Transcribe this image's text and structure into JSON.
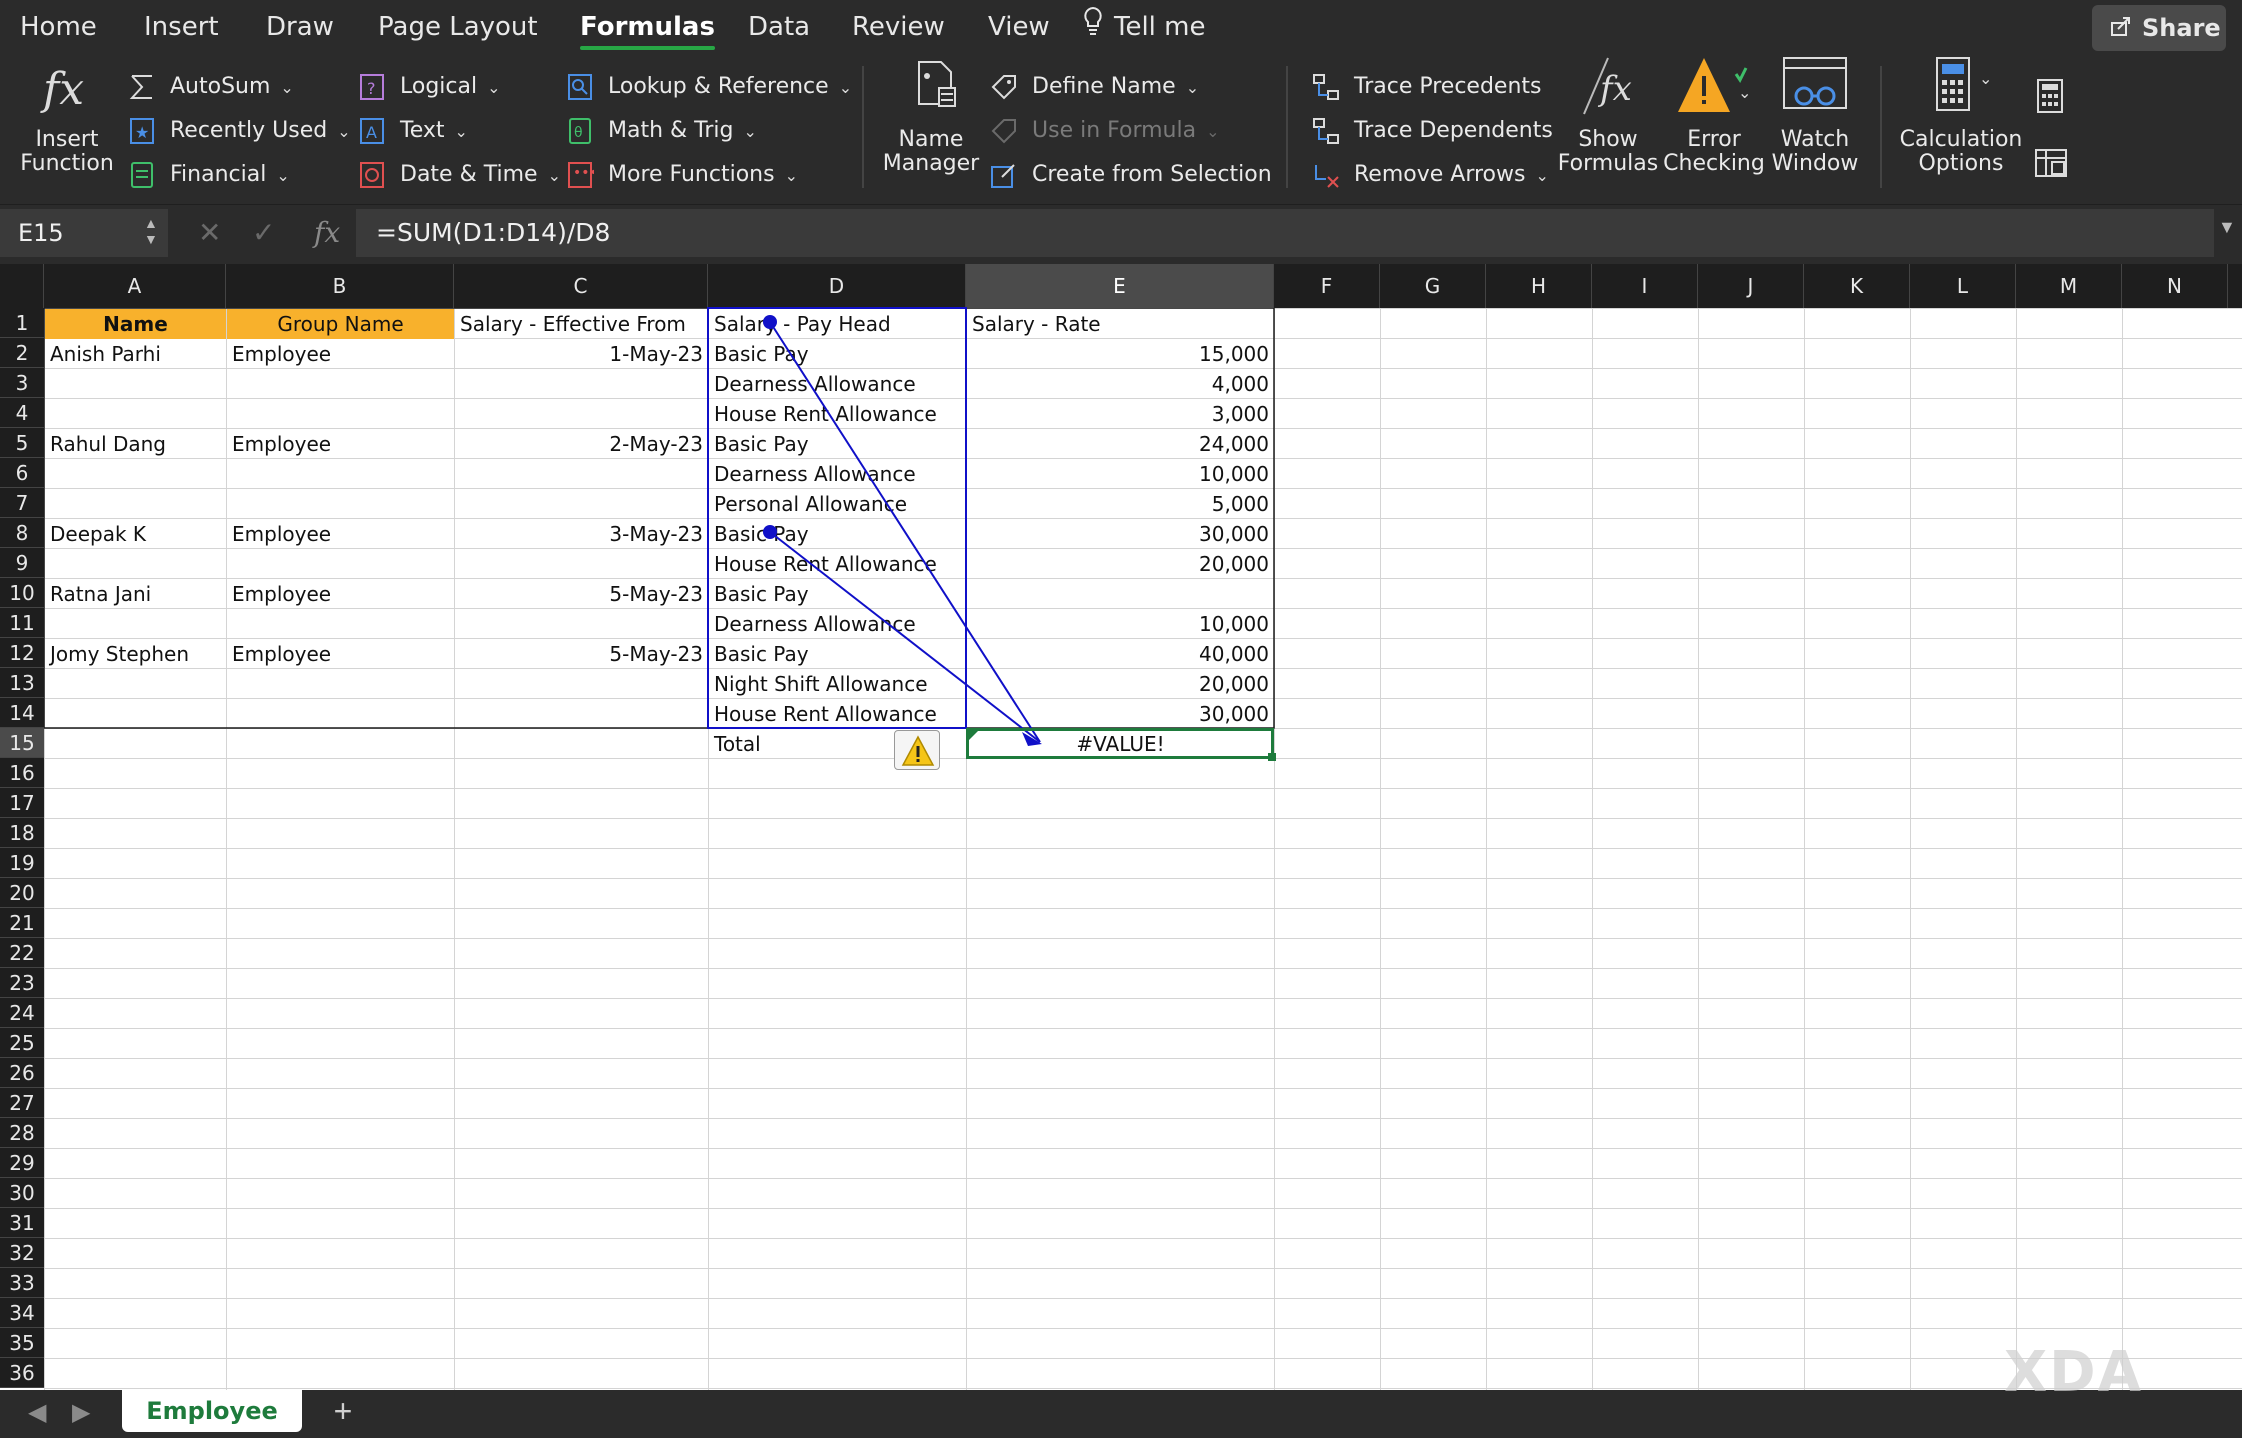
{
  "tabs": [
    "Home",
    "Insert",
    "Draw",
    "Page Layout",
    "Formulas",
    "Data",
    "Review",
    "View"
  ],
  "active_tab": "Formulas",
  "tell_me": "Tell me",
  "share_label": "Share",
  "ribbon": {
    "insert_function": [
      "Insert",
      "Function"
    ],
    "library": {
      "autosum": "AutoSum",
      "recently_used": "Recently Used",
      "financial": "Financial",
      "logical": "Logical",
      "text": "Text",
      "date_time": "Date & Time",
      "lookup": "Lookup & Reference",
      "math": "Math & Trig",
      "more": "More Functions"
    },
    "name_manager": [
      "Name",
      "Manager"
    ],
    "define_name": "Define Name",
    "use_in_formula": "Use in Formula",
    "create_from_selection": "Create from Selection",
    "trace_precedents": "Trace Precedents",
    "trace_dependents": "Trace Dependents",
    "remove_arrows": "Remove Arrows",
    "show_formulas": [
      "Show",
      "Formulas"
    ],
    "error_checking": [
      "Error",
      "Checking"
    ],
    "watch_window": [
      "Watch",
      "Window"
    ],
    "calc_options": [
      "Calculation",
      "Options"
    ]
  },
  "formula_bar": {
    "name_box": "E15",
    "formula": "=SUM(D1:D14)/D8"
  },
  "columns": [
    "A",
    "B",
    "C",
    "D",
    "E",
    "F",
    "G",
    "H",
    "I",
    "J",
    "K",
    "L",
    "M",
    "N"
  ],
  "selected_column": "E",
  "selected_row": "15",
  "rows": [
    "1",
    "2",
    "3",
    "4",
    "5",
    "6",
    "7",
    "8",
    "9",
    "10",
    "11",
    "12",
    "13",
    "14",
    "15",
    "16",
    "17",
    "18",
    "19",
    "20",
    "21",
    "22",
    "23",
    "24",
    "25",
    "26",
    "27",
    "28",
    "29",
    "30",
    "31",
    "32",
    "33",
    "34",
    "35",
    "36"
  ],
  "header": {
    "name": "Name",
    "group": "Group Name",
    "effective": "Salary - Effective From",
    "pay_head": "Salary - Pay Head",
    "rate": "Salary - Rate"
  },
  "data_rows": [
    {
      "name": "Anish Parhi",
      "group": "Employee",
      "date": "1-May-23",
      "head": "Basic Pay",
      "rate": "15,000"
    },
    {
      "name": "",
      "group": "",
      "date": "",
      "head": "Dearness Allowance",
      "rate": "4,000"
    },
    {
      "name": "",
      "group": "",
      "date": "",
      "head": "House Rent Allowance",
      "rate": "3,000"
    },
    {
      "name": "Rahul Dang",
      "group": "Employee",
      "date": "2-May-23",
      "head": "Basic Pay",
      "rate": "24,000"
    },
    {
      "name": "",
      "group": "",
      "date": "",
      "head": "Dearness Allowance",
      "rate": "10,000"
    },
    {
      "name": "",
      "group": "",
      "date": "",
      "head": "Personal Allowance",
      "rate": "5,000"
    },
    {
      "name": "Deepak K",
      "group": "Employee",
      "date": "3-May-23",
      "head": "Basic Pay",
      "rate": "30,000"
    },
    {
      "name": "",
      "group": "",
      "date": "",
      "head": "House Rent Allowance",
      "rate": "20,000"
    },
    {
      "name": "Ratna Jani",
      "group": "Employee",
      "date": "5-May-23",
      "head": "Basic Pay",
      "rate": ""
    },
    {
      "name": "",
      "group": "",
      "date": "",
      "head": "Dearness Allowance",
      "rate": "10,000"
    },
    {
      "name": "Jomy Stephen",
      "group": "Employee",
      "date": "5-May-23",
      "head": "Basic Pay",
      "rate": "40,000"
    },
    {
      "name": "",
      "group": "",
      "date": "",
      "head": "Night Shift Allowance",
      "rate": "20,000"
    },
    {
      "name": "",
      "group": "",
      "date": "",
      "head": "House Rent Allowance",
      "rate": "30,000"
    }
  ],
  "total_label": "Total",
  "total_value": "#VALUE!",
  "sheet_tab": "Employee",
  "watermark": "XDA",
  "colors": {
    "header_fill": "#f8b12c",
    "accent_green": "#1e7b3c",
    "trace_arrow": "#1010c8",
    "warning": "#f5c518"
  }
}
